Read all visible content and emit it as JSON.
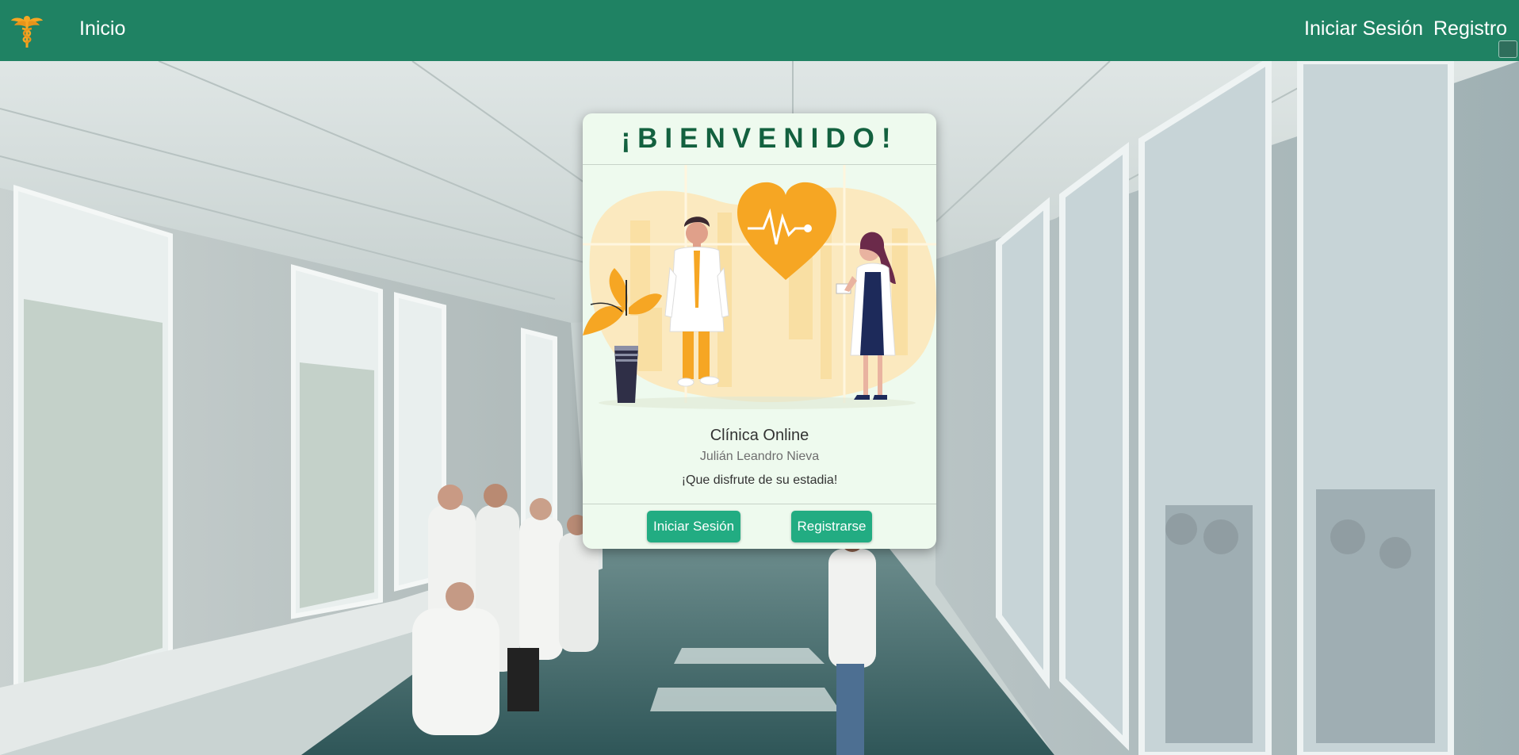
{
  "navbar": {
    "home_label": "Inicio",
    "login_label": "Iniciar Sesión",
    "register_label": "Registro",
    "background_color": "#1f8263",
    "logo_icon": "caduceus-icon"
  },
  "card": {
    "title": "¡BIENVENIDO!",
    "clinic_name": "Clínica Online",
    "author": "Julián Leandro Nieva",
    "message": "¡Que disfrute de su estadia!",
    "login_button": "Iniciar Sesión",
    "register_button": "Registrarse",
    "illustration_icon": "doctors-heart-illustration"
  },
  "colors": {
    "accent": "#22ac82",
    "title": "#13613f",
    "card_background": "#eefaee",
    "heart": "#f6a623"
  }
}
